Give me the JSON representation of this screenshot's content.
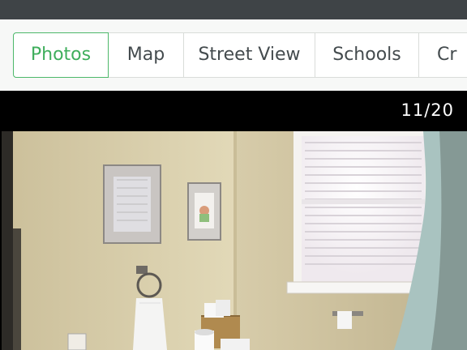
{
  "tabs": [
    {
      "label": "Photos",
      "active": true
    },
    {
      "label": "Map",
      "active": false
    },
    {
      "label": "Street View",
      "active": false
    },
    {
      "label": "Schools",
      "active": false
    },
    {
      "label": "Cr",
      "active": false
    }
  ],
  "viewer": {
    "counter": "11/20",
    "photo_subject": "bathroom"
  },
  "colors": {
    "topbar": "#3f4447",
    "accent_green": "#3fae5c",
    "tab_border": "#d9dcd9",
    "viewer_bg": "#000000"
  }
}
